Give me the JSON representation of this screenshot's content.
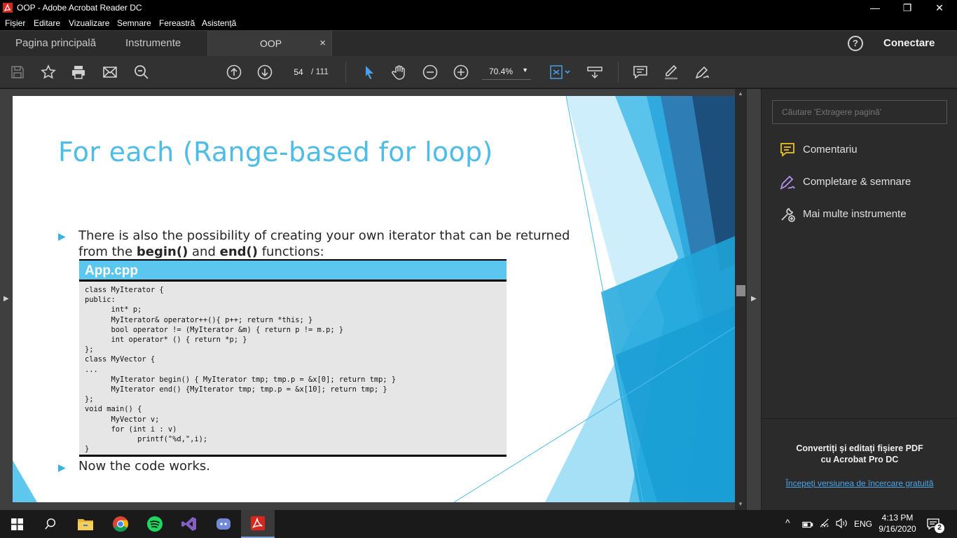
{
  "window": {
    "title": "OOP - Adobe Acrobat Reader DC",
    "controls": {
      "minimize": "—",
      "restore": "❐",
      "close": "✕"
    }
  },
  "menu": [
    "Fișier",
    "Editare",
    "Vizualizare",
    "Semnare",
    "Fereastră",
    "Asistență"
  ],
  "tabs": {
    "home": "Pagina principală",
    "tools": "Instrumente",
    "document": "OOP",
    "close": "×",
    "help": "?",
    "signin": "Conectare"
  },
  "toolbar": {
    "page_current": "54",
    "page_total": "/ 111",
    "zoom": "70.4%",
    "zoom_caret": "▼"
  },
  "slide": {
    "title": "For each (Range-based for loop)",
    "bullet_glyph": "▶",
    "bullet1_line1": "There is also the possibility of creating your own iterator that can be returned",
    "bullet1_line2_pre": "from the ",
    "bullet1_begin": "begin()",
    "bullet1_and": " and ",
    "bullet1_end": "end()",
    "bullet1_post": " functions:",
    "code_header": "App.cpp",
    "code": "class MyIterator {\npublic:\n      int* p;\n      MyIterator& operator++(){ p++; return *this; }\n      bool operator != (MyIterator &m) { return p != m.p; }\n      int operator* () { return *p; }\n};\nclass MyVector {\n...\n      MyIterator begin() { MyIterator tmp; tmp.p = &x[0]; return tmp; }\n      MyIterator end() {MyIterator tmp; tmp.p = &x[10]; return tmp; }\n};\nvoid main() {\n      MyVector v;\n      for (int i : v)\n            printf(\"%d,\",i);\n}",
    "bullet2": "Now the code works."
  },
  "right_panel": {
    "search_placeholder": "Căutare 'Extragere pagină'",
    "tools": [
      "Comentariu",
      "Completare & semnare",
      "Mai multe instrumente"
    ],
    "promo_line1": "Convertiți și editați fișiere PDF",
    "promo_line2": "cu Acrobat Pro DC",
    "trial_link": "Începeți versiunea de încercare gratuită"
  },
  "taskbar": {
    "language": "ENG",
    "time": "4:13 PM",
    "date": "9/16/2020",
    "notification_count": "2",
    "tray_caret": "^"
  },
  "colors": {
    "slide_accent": "#4dbde8",
    "code_header_bg": "#5bc6ee",
    "link": "#4da6e8",
    "comment_icon": "#f0c419",
    "sign_icon": "#b58ff0"
  }
}
